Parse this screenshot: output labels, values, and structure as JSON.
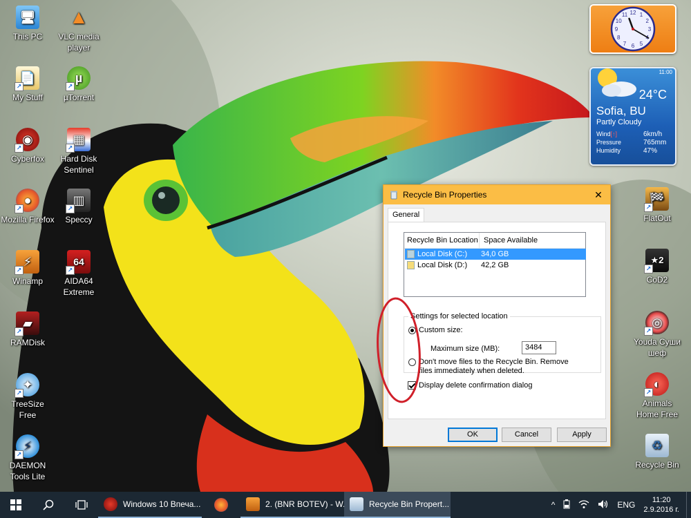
{
  "desktop": {
    "icons_left": [
      {
        "label": "This PC",
        "icon": "computer-icon"
      },
      {
        "label": "My Stuff",
        "icon": "folder-icon"
      },
      {
        "label": "Cyberfox",
        "icon": "cyberfox-icon"
      },
      {
        "label": "Mozilla Firefox",
        "icon": "firefox-icon"
      },
      {
        "label": "Winamp",
        "icon": "winamp-icon"
      },
      {
        "label": "RAMDisk",
        "icon": "ramdisk-icon"
      },
      {
        "label": "TreeSize Free",
        "icon": "treesize-icon"
      },
      {
        "label": "DAEMON Tools Lite",
        "icon": "daemon-tools-icon"
      }
    ],
    "icons_col2": [
      {
        "label": "VLC media player",
        "icon": "vlc-icon"
      },
      {
        "label": "µTorrent",
        "icon": "utorrent-icon"
      },
      {
        "label": "Hard Disk Sentinel",
        "icon": "hdsentinel-icon"
      },
      {
        "label": "Speccy",
        "icon": "speccy-icon"
      },
      {
        "label": "AIDA64 Extreme",
        "icon": "aida64-icon",
        "badge": "64"
      }
    ],
    "icons_right": [
      {
        "label": "FlatOut",
        "icon": "flatout-icon"
      },
      {
        "label": "CoD2",
        "icon": "cod2-icon",
        "badge": "2"
      },
      {
        "label": "Youda Суши шеф",
        "icon": "sushi-icon"
      },
      {
        "label": "Animals Home Free",
        "icon": "animals-icon"
      },
      {
        "label": "Recycle Bin",
        "icon": "recycle-bin-icon"
      }
    ]
  },
  "clock_gadget": {
    "hour": 11,
    "minute": 20,
    "numerals": [
      "12",
      "1",
      "2",
      "3",
      "4",
      "5",
      "6",
      "7",
      "8",
      "9",
      "10",
      "11"
    ]
  },
  "weather_gadget": {
    "time": "11:00",
    "temperature": "24°C",
    "city": "Sofia, BU",
    "condition": "Partly Cloudy",
    "wind_label": "Wind",
    "wind_dir": "[↑]",
    "wind_value": "6km/h",
    "pressure_label": "Pressure",
    "pressure_value": "765mm",
    "humidity_label": "Humidity",
    "humidity_value": "47%"
  },
  "dialog": {
    "title": "Recycle Bin Properties",
    "close_glyph": "✕",
    "tab_general": "General",
    "list": {
      "col_location": "Recycle Bin Location",
      "col_space": "Space Available",
      "rows": [
        {
          "name": "Local Disk (C:)",
          "space": "34,0 GB",
          "selected": true
        },
        {
          "name": "Local Disk (D:)",
          "space": "42,2 GB",
          "selected": false
        }
      ]
    },
    "settings_legend": "Settings for selected location",
    "custom_size_label": "Custom size:",
    "max_size_label": "Maximum size (MB):",
    "max_size_value": "3484",
    "dont_move_label": "Don't move files to the Recycle Bin. Remove files immediately when deleted.",
    "confirm_label": "Display delete confirmation dialog",
    "ok_label": "OK",
    "cancel_label": "Cancel",
    "apply_label": "Apply"
  },
  "taskbar": {
    "apps": [
      {
        "label": "Windows 10 Впеча...",
        "icon": "cyberfox-icon"
      },
      {
        "label": "",
        "icon": "firefox-icon"
      },
      {
        "label": "2. (BNR BOTEV) - W...",
        "icon": "winamp-icon"
      },
      {
        "label": "Recycle Bin Propert...",
        "icon": "recycle-bin-icon"
      }
    ],
    "chevron": "^",
    "lang": "ENG",
    "time": "11:20",
    "date": "2.9.2016 г."
  },
  "colors": {
    "dialog_title_bg": "#fbbd45",
    "selection": "#3399ff",
    "taskbar": "#1c2833",
    "annotation_circle": "#d0202a"
  }
}
